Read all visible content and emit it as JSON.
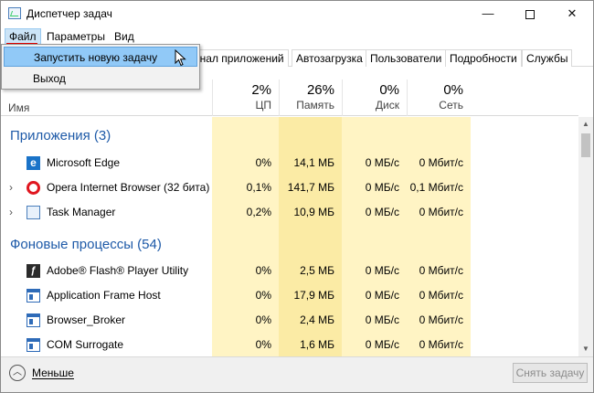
{
  "window": {
    "title": "Диспетчер задач",
    "minimize": "—",
    "maximize": "",
    "close": "✕"
  },
  "menu": {
    "file": "Файл",
    "params": "Параметры",
    "view": "Вид"
  },
  "dropdown": {
    "run_task": "Запустить новую задачу",
    "exit": "Выход"
  },
  "tabs": [
    "рнал приложений",
    "Автозагрузка",
    "Пользователи",
    "Подробности",
    "Службы"
  ],
  "header": {
    "name": "Имя",
    "cpu": {
      "pct": "2%",
      "label": "ЦП"
    },
    "mem": {
      "pct": "26%",
      "label": "Память"
    },
    "disk": {
      "pct": "0%",
      "label": "Диск"
    },
    "net": {
      "pct": "0%",
      "label": "Сеть"
    }
  },
  "groups": {
    "apps": "Приложения (3)",
    "background": "Фоновые процессы (54)"
  },
  "processes": [
    {
      "name": "Microsoft Edge",
      "cpu": "0%",
      "mem": "14,1 МБ",
      "disk": "0 МБ/с",
      "net": "0 Мбит/с",
      "expander": ""
    },
    {
      "name": "Opera Internet Browser (32 бита)",
      "cpu": "0,1%",
      "mem": "141,7 МБ",
      "disk": "0 МБ/с",
      "net": "0,1 Мбит/с",
      "expander": "›"
    },
    {
      "name": "Task Manager",
      "cpu": "0,2%",
      "mem": "10,9 МБ",
      "disk": "0 МБ/с",
      "net": "0 Мбит/с",
      "expander": "›"
    },
    {
      "name": "Adobe® Flash® Player Utility",
      "cpu": "0%",
      "mem": "2,5 МБ",
      "disk": "0 МБ/с",
      "net": "0 Мбит/с",
      "expander": ""
    },
    {
      "name": "Application Frame Host",
      "cpu": "0%",
      "mem": "17,9 МБ",
      "disk": "0 МБ/с",
      "net": "0 Мбит/с",
      "expander": ""
    },
    {
      "name": "Browser_Broker",
      "cpu": "0%",
      "mem": "2,4 МБ",
      "disk": "0 МБ/с",
      "net": "0 Мбит/с",
      "expander": ""
    },
    {
      "name": "COM Surrogate",
      "cpu": "0%",
      "mem": "1,6 МБ",
      "disk": "0 МБ/с",
      "net": "0 Мбит/с",
      "expander": ""
    }
  ],
  "footer": {
    "less": "Меньше",
    "end_task": "Снять задачу"
  },
  "colors": {
    "cpu_bg": "#fff4c4",
    "mem_bg": "#fbeba5",
    "group": "#1e5aa8",
    "highlight": "#91c9f7",
    "annotation": "#dd0000"
  },
  "icons": [
    "taskmgr-icon",
    "edge-icon",
    "opera-icon",
    "taskmgr-icon",
    "flash-icon",
    "window-icon",
    "window-icon",
    "window-icon",
    "chevron-up-icon",
    "mouse-cursor-icon"
  ]
}
